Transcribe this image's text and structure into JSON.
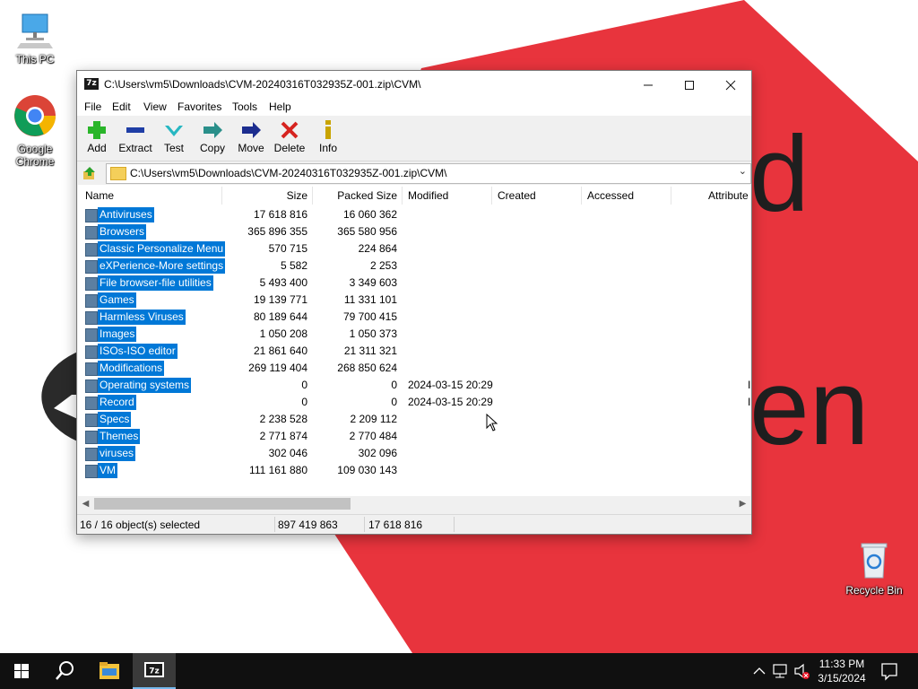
{
  "desktop": {
    "icons": [
      {
        "label": "This PC",
        "icon": "computer-icon"
      },
      {
        "label": "Google Chrome",
        "icon": "chrome-icon"
      },
      {
        "label": "Recycle Bin",
        "icon": "recycle-bin-icon"
      }
    ],
    "wallpaper": {
      "accent": "#e8343d",
      "text_color": "#1a1a1a"
    }
  },
  "window": {
    "title": "C:\\Users\\vm5\\Downloads\\CVM-20240316T032935Z-001.zip\\CVM\\",
    "app_icon_text": "7z",
    "menu": [
      "File",
      "Edit",
      "View",
      "Favorites",
      "Tools",
      "Help"
    ],
    "toolbar": [
      {
        "label": "Add",
        "icon": "plus-icon"
      },
      {
        "label": "Extract",
        "icon": "minus-icon"
      },
      {
        "label": "Test",
        "icon": "check-icon"
      },
      {
        "label": "Copy",
        "icon": "copy-arrow-icon"
      },
      {
        "label": "Move",
        "icon": "move-arrow-icon"
      },
      {
        "label": "Delete",
        "icon": "delete-x-icon"
      },
      {
        "label": "Info",
        "icon": "info-icon"
      }
    ],
    "address": "C:\\Users\\vm5\\Downloads\\CVM-20240316T032935Z-001.zip\\CVM\\",
    "columns": [
      "Name",
      "Size",
      "Packed Size",
      "Modified",
      "Created",
      "Accessed",
      "Attribute"
    ],
    "rows": [
      {
        "name": "Antiviruses",
        "size": "17 618 816",
        "packed": "16 060 362",
        "modified": "",
        "attr": ""
      },
      {
        "name": "Browsers",
        "size": "365 896 355",
        "packed": "365 580 956",
        "modified": "",
        "attr": ""
      },
      {
        "name": "Classic Personalize Menu",
        "size": "570 715",
        "packed": "224 864",
        "modified": "",
        "attr": ""
      },
      {
        "name": "eXPerience-More settings",
        "size": "5 582",
        "packed": "2 253",
        "modified": "",
        "attr": ""
      },
      {
        "name": "File browser-file utilities",
        "size": "5 493 400",
        "packed": "3 349 603",
        "modified": "",
        "attr": ""
      },
      {
        "name": "Games",
        "size": "19 139 771",
        "packed": "11 331 101",
        "modified": "",
        "attr": ""
      },
      {
        "name": "Harmless Viruses",
        "size": "80 189 644",
        "packed": "79 700 415",
        "modified": "",
        "attr": ""
      },
      {
        "name": "Images",
        "size": "1 050 208",
        "packed": "1 050 373",
        "modified": "",
        "attr": ""
      },
      {
        "name": "ISOs-ISO editor",
        "size": "21 861 640",
        "packed": "21 311 321",
        "modified": "",
        "attr": ""
      },
      {
        "name": "Modifications",
        "size": "269 119 404",
        "packed": "268 850 624",
        "modified": "",
        "attr": ""
      },
      {
        "name": "Operating systems",
        "size": "0",
        "packed": "0",
        "modified": "2024-03-15 20:29",
        "attr": "I"
      },
      {
        "name": "Record",
        "size": "0",
        "packed": "0",
        "modified": "2024-03-15 20:29",
        "attr": "I"
      },
      {
        "name": "Specs",
        "size": "2 238 528",
        "packed": "2 209 112",
        "modified": "",
        "attr": ""
      },
      {
        "name": "Themes",
        "size": "2 771 874",
        "packed": "2 770 484",
        "modified": "",
        "attr": ""
      },
      {
        "name": "viruses",
        "size": "302 046",
        "packed": "302 096",
        "modified": "",
        "attr": ""
      },
      {
        "name": "VM",
        "size": "111 161 880",
        "packed": "109 030 143",
        "modified": "",
        "attr": ""
      }
    ],
    "status": {
      "selected": "16 / 16 object(s) selected",
      "total_size": "897 419 863",
      "item_size": "17 618 816"
    },
    "selection_color": "#0078d7"
  },
  "taskbar": {
    "time": "11:33 PM",
    "date": "3/15/2024",
    "apps": [
      "start-icon",
      "search-icon",
      "file-explorer-icon",
      "7zip-icon"
    ],
    "tray": [
      "chevron-up-icon",
      "network-icon",
      "volume-muted-icon",
      "notification-icon"
    ]
  }
}
